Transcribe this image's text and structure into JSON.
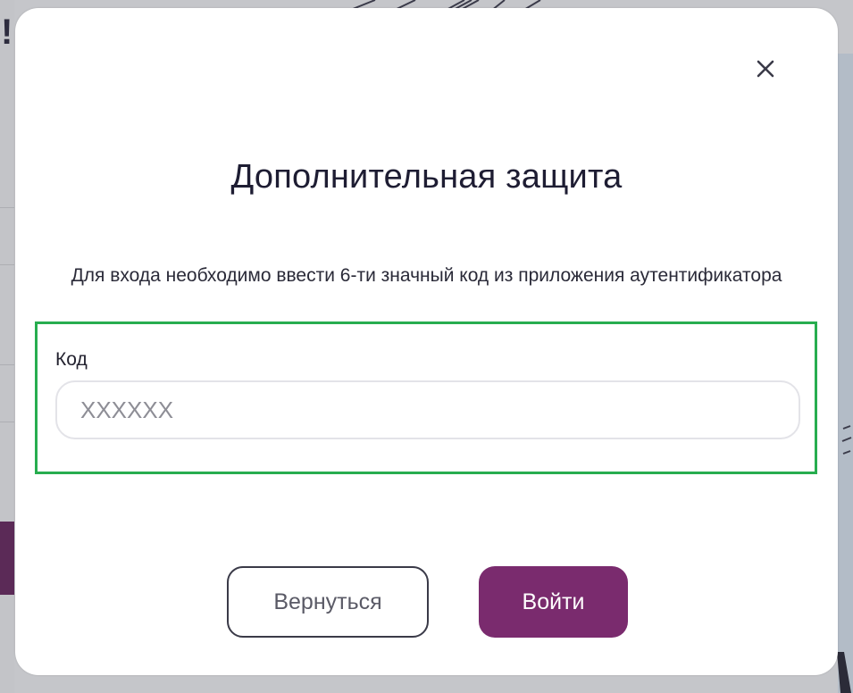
{
  "background": {
    "exclaim_text": "!"
  },
  "modal": {
    "close_icon": "close-icon",
    "title": "Дополнительная защита",
    "description": "Для входа необходимо ввести 6-ти значный код из приложения аутентификатора",
    "code_field": {
      "label": "Код",
      "placeholder": "XXXXXX",
      "value": ""
    },
    "buttons": {
      "back_label": "Вернуться",
      "login_label": "Войти"
    }
  },
  "colors": {
    "primary": "#7a2b6e",
    "highlight_border": "#27ad4f",
    "title_text": "#1e1d33"
  }
}
